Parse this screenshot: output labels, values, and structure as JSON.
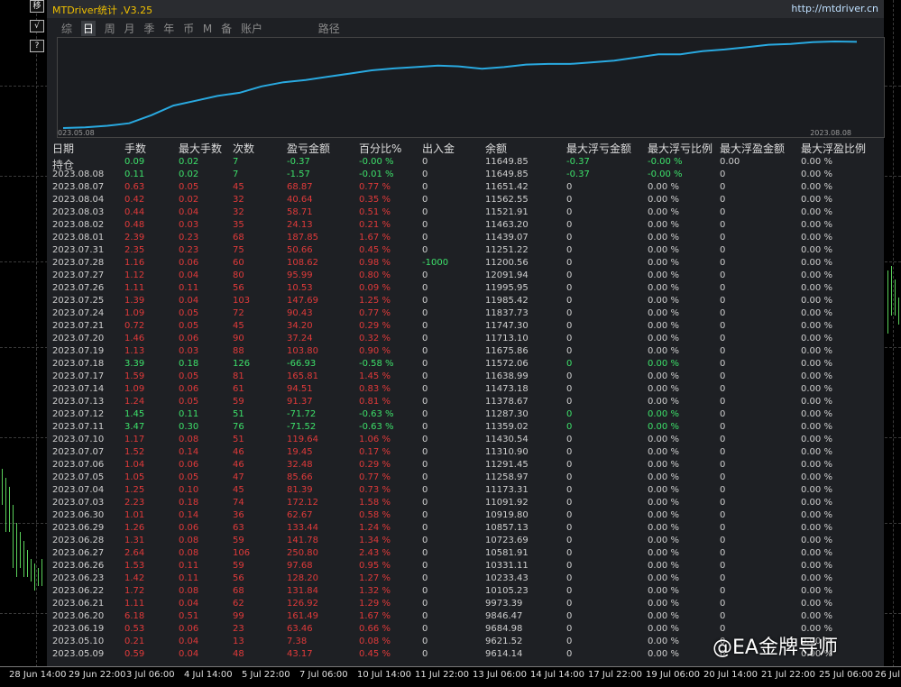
{
  "window": {
    "title": "MTDriver统计 ,V3.25",
    "url": "http://mtdriver.cn"
  },
  "side_buttons": [
    "移",
    "√",
    "?"
  ],
  "tabs": [
    {
      "label": "综",
      "active": false
    },
    {
      "label": "日",
      "active": true
    },
    {
      "label": "周",
      "active": false
    },
    {
      "label": "月",
      "active": false
    },
    {
      "label": "季",
      "active": false
    },
    {
      "label": "年",
      "active": false
    },
    {
      "label": "币",
      "active": false
    },
    {
      "label": "M",
      "active": false
    },
    {
      "label": "备",
      "active": false
    },
    {
      "label": "账户",
      "active": false
    },
    {
      "label": "路径",
      "active": false
    }
  ],
  "chart_data": {
    "type": "line",
    "x_start_label": "023.05.08",
    "x_end_label": "2023.08.08",
    "color": "#29a9e0",
    "values": [
      10000,
      10020,
      10070,
      10150,
      10400,
      10700,
      10850,
      11000,
      11100,
      11300,
      11430,
      11500,
      11600,
      11700,
      11800,
      11860,
      11900,
      11950,
      11920,
      11850,
      11900,
      11980,
      12000,
      12000,
      12050,
      12100,
      12200,
      12300,
      12300,
      12400,
      12450,
      12520,
      12600,
      12620,
      12680,
      12700,
      12690
    ]
  },
  "table": {
    "headers": [
      "日期",
      "手数",
      "最大手数",
      "次数",
      "盈亏金额",
      "百分比%",
      "出入金",
      "余额",
      "最大浮亏金额",
      "最大浮亏比例",
      "最大浮盈金额",
      "最大浮盈比例"
    ],
    "rows": [
      {
        "c": [
          "持仓",
          "0.09",
          "0.02",
          "7",
          "-0.37",
          "-0.00 %",
          "0",
          "11649.85",
          "-0.37",
          "-0.00 %",
          "0.00",
          "0.00 %"
        ],
        "t": "g",
        "hl": true
      },
      {
        "c": [
          "2023.08.08",
          "0.11",
          "0.02",
          "7",
          "-1.57",
          "-0.01 %",
          "0",
          "11649.85",
          "-0.37",
          "-0.00 %",
          "0",
          "0.00 %"
        ],
        "t": "g"
      },
      {
        "c": [
          "2023.08.07",
          "0.63",
          "0.05",
          "45",
          "68.87",
          "0.77 %",
          "0",
          "11651.42",
          "0",
          "0.00 %",
          "0",
          "0.00 %"
        ],
        "t": "r"
      },
      {
        "c": [
          "2023.08.04",
          "0.42",
          "0.02",
          "32",
          "40.64",
          "0.35 %",
          "0",
          "11562.55",
          "0",
          "0.00 %",
          "0",
          "0.00 %"
        ],
        "t": "r"
      },
      {
        "c": [
          "2023.08.03",
          "0.44",
          "0.04",
          "32",
          "58.71",
          "0.51 %",
          "0",
          "11521.91",
          "0",
          "0.00 %",
          "0",
          "0.00 %"
        ],
        "t": "r"
      },
      {
        "c": [
          "2023.08.02",
          "0.48",
          "0.03",
          "35",
          "24.13",
          "0.21 %",
          "0",
          "11463.20",
          "0",
          "0.00 %",
          "0",
          "0.00 %"
        ],
        "t": "r"
      },
      {
        "c": [
          "2023.08.01",
          "2.39",
          "0.23",
          "68",
          "187.85",
          "1.67 %",
          "0",
          "11439.07",
          "0",
          "0.00 %",
          "0",
          "0.00 %"
        ],
        "t": "r"
      },
      {
        "c": [
          "2023.07.31",
          "2.35",
          "0.23",
          "75",
          "50.66",
          "0.45 %",
          "0",
          "11251.22",
          "0",
          "0.00 %",
          "0",
          "0.00 %"
        ],
        "t": "r"
      },
      {
        "c": [
          "2023.07.28",
          "1.16",
          "0.06",
          "60",
          "108.62",
          "0.98 %",
          "-1000",
          "11200.56",
          "0",
          "0.00 %",
          "0",
          "0.00 %"
        ],
        "t": "r",
        "inout": "g"
      },
      {
        "c": [
          "2023.07.27",
          "1.12",
          "0.04",
          "80",
          "95.99",
          "0.80 %",
          "0",
          "12091.94",
          "0",
          "0.00 %",
          "0",
          "0.00 %"
        ],
        "t": "r"
      },
      {
        "c": [
          "2023.07.26",
          "1.11",
          "0.11",
          "56",
          "10.53",
          "0.09 %",
          "0",
          "11995.95",
          "0",
          "0.00 %",
          "0",
          "0.00 %"
        ],
        "t": "r"
      },
      {
        "c": [
          "2023.07.25",
          "1.39",
          "0.04",
          "103",
          "147.69",
          "1.25 %",
          "0",
          "11985.42",
          "0",
          "0.00 %",
          "0",
          "0.00 %"
        ],
        "t": "r"
      },
      {
        "c": [
          "2023.07.24",
          "1.09",
          "0.05",
          "72",
          "90.43",
          "0.77 %",
          "0",
          "11837.73",
          "0",
          "0.00 %",
          "0",
          "0.00 %"
        ],
        "t": "r"
      },
      {
        "c": [
          "2023.07.21",
          "0.72",
          "0.05",
          "45",
          "34.20",
          "0.29 %",
          "0",
          "11747.30",
          "0",
          "0.00 %",
          "0",
          "0.00 %"
        ],
        "t": "r"
      },
      {
        "c": [
          "2023.07.20",
          "1.46",
          "0.06",
          "90",
          "37.24",
          "0.32 %",
          "0",
          "11713.10",
          "0",
          "0.00 %",
          "0",
          "0.00 %"
        ],
        "t": "r"
      },
      {
        "c": [
          "2023.07.19",
          "1.13",
          "0.03",
          "88",
          "103.80",
          "0.90 %",
          "0",
          "11675.86",
          "0",
          "0.00 %",
          "0",
          "0.00 %"
        ],
        "t": "r"
      },
      {
        "c": [
          "2023.07.18",
          "3.39",
          "0.18",
          "126",
          "-66.93",
          "-0.58 %",
          "0",
          "11572.06",
          "0",
          "0.00 %",
          "0",
          "0.00 %"
        ],
        "t": "g"
      },
      {
        "c": [
          "2023.07.17",
          "1.59",
          "0.05",
          "81",
          "165.81",
          "1.45 %",
          "0",
          "11638.99",
          "0",
          "0.00 %",
          "0",
          "0.00 %"
        ],
        "t": "r"
      },
      {
        "c": [
          "2023.07.14",
          "1.09",
          "0.06",
          "61",
          "94.51",
          "0.83 %",
          "0",
          "11473.18",
          "0",
          "0.00 %",
          "0",
          "0.00 %"
        ],
        "t": "r"
      },
      {
        "c": [
          "2023.07.13",
          "1.24",
          "0.05",
          "59",
          "91.37",
          "0.81 %",
          "0",
          "11378.67",
          "0",
          "0.00 %",
          "0",
          "0.00 %"
        ],
        "t": "r"
      },
      {
        "c": [
          "2023.07.12",
          "1.45",
          "0.11",
          "51",
          "-71.72",
          "-0.63 %",
          "0",
          "11287.30",
          "0",
          "0.00 %",
          "0",
          "0.00 %"
        ],
        "t": "g"
      },
      {
        "c": [
          "2023.07.11",
          "3.47",
          "0.30",
          "76",
          "-71.52",
          "-0.63 %",
          "0",
          "11359.02",
          "0",
          "0.00 %",
          "0",
          "0.00 %"
        ],
        "t": "g"
      },
      {
        "c": [
          "2023.07.10",
          "1.17",
          "0.08",
          "51",
          "119.64",
          "1.06 %",
          "0",
          "11430.54",
          "0",
          "0.00 %",
          "0",
          "0.00 %"
        ],
        "t": "r"
      },
      {
        "c": [
          "2023.07.07",
          "1.52",
          "0.14",
          "46",
          "19.45",
          "0.17 %",
          "0",
          "11310.90",
          "0",
          "0.00 %",
          "0",
          "0.00 %"
        ],
        "t": "r"
      },
      {
        "c": [
          "2023.07.06",
          "1.04",
          "0.06",
          "46",
          "32.48",
          "0.29 %",
          "0",
          "11291.45",
          "0",
          "0.00 %",
          "0",
          "0.00 %"
        ],
        "t": "r"
      },
      {
        "c": [
          "2023.07.05",
          "1.05",
          "0.05",
          "47",
          "85.66",
          "0.77 %",
          "0",
          "11258.97",
          "0",
          "0.00 %",
          "0",
          "0.00 %"
        ],
        "t": "r"
      },
      {
        "c": [
          "2023.07.04",
          "1.25",
          "0.10",
          "45",
          "81.39",
          "0.73 %",
          "0",
          "11173.31",
          "0",
          "0.00 %",
          "0",
          "0.00 %"
        ],
        "t": "r"
      },
      {
        "c": [
          "2023.07.03",
          "2.23",
          "0.18",
          "74",
          "172.12",
          "1.58 %",
          "0",
          "11091.92",
          "0",
          "0.00 %",
          "0",
          "0.00 %"
        ],
        "t": "r"
      },
      {
        "c": [
          "2023.06.30",
          "1.01",
          "0.14",
          "36",
          "62.67",
          "0.58 %",
          "0",
          "10919.80",
          "0",
          "0.00 %",
          "0",
          "0.00 %"
        ],
        "t": "r"
      },
      {
        "c": [
          "2023.06.29",
          "1.26",
          "0.06",
          "63",
          "133.44",
          "1.24 %",
          "0",
          "10857.13",
          "0",
          "0.00 %",
          "0",
          "0.00 %"
        ],
        "t": "r"
      },
      {
        "c": [
          "2023.06.28",
          "1.31",
          "0.08",
          "59",
          "141.78",
          "1.34 %",
          "0",
          "10723.69",
          "0",
          "0.00 %",
          "0",
          "0.00 %"
        ],
        "t": "r"
      },
      {
        "c": [
          "2023.06.27",
          "2.64",
          "0.08",
          "106",
          "250.80",
          "2.43 %",
          "0",
          "10581.91",
          "0",
          "0.00 %",
          "0",
          "0.00 %"
        ],
        "t": "r"
      },
      {
        "c": [
          "2023.06.26",
          "1.53",
          "0.11",
          "59",
          "97.68",
          "0.95 %",
          "0",
          "10331.11",
          "0",
          "0.00 %",
          "0",
          "0.00 %"
        ],
        "t": "r"
      },
      {
        "c": [
          "2023.06.23",
          "1.42",
          "0.11",
          "56",
          "128.20",
          "1.27 %",
          "0",
          "10233.43",
          "0",
          "0.00 %",
          "0",
          "0.00 %"
        ],
        "t": "r"
      },
      {
        "c": [
          "2023.06.22",
          "1.72",
          "0.08",
          "68",
          "131.84",
          "1.32 %",
          "0",
          "10105.23",
          "0",
          "0.00 %",
          "0",
          "0.00 %"
        ],
        "t": "r"
      },
      {
        "c": [
          "2023.06.21",
          "1.11",
          "0.04",
          "62",
          "126.92",
          "1.29 %",
          "0",
          "9973.39",
          "0",
          "0.00 %",
          "0",
          "0.00 %"
        ],
        "t": "r"
      },
      {
        "c": [
          "2023.06.20",
          "6.18",
          "0.51",
          "99",
          "161.49",
          "1.67 %",
          "0",
          "9846.47",
          "0",
          "0.00 %",
          "0",
          "0.00 %"
        ],
        "t": "r"
      },
      {
        "c": [
          "2023.06.19",
          "0.53",
          "0.06",
          "23",
          "63.46",
          "0.66 %",
          "0",
          "9684.98",
          "0",
          "0.00 %",
          "0",
          "0.00 %"
        ],
        "t": "r"
      },
      {
        "c": [
          "2023.05.10",
          "0.21",
          "0.04",
          "13",
          "7.38",
          "0.08 %",
          "0",
          "9621.52",
          "0",
          "0.00 %",
          "0",
          "0.00 %"
        ],
        "t": "r"
      },
      {
        "c": [
          "2023.05.09",
          "0.59",
          "0.04",
          "48",
          "43.17",
          "0.45 %",
          "0",
          "9614.14",
          "0",
          "0.00 %",
          "0",
          "0.00 %"
        ],
        "t": "r"
      }
    ]
  },
  "time_axis": [
    "28 Jun 14:00",
    "29 Jun 22:00",
    "3 Jul 06:00",
    "4 Jul 14:00",
    "5 Jul 22:00",
    "7 Jul 06:00",
    "10 Jul 14:00",
    "11 Jul 22:00",
    "13 Jul 06:00",
    "14 Jul 14:00",
    "17 Jul 22:00",
    "19 Jul 06:00",
    "20 Jul 14:00",
    "21 Jul 22:00",
    "25 Jul 06:00",
    "26 Jul"
  ],
  "watermark": "@EA金牌导师"
}
